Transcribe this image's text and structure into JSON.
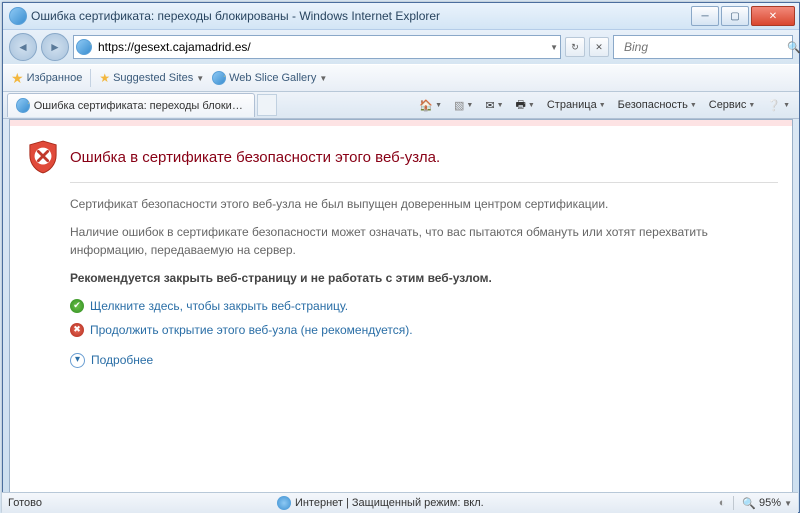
{
  "window": {
    "title": "Ошибка сертификата: переходы блокированы - Windows Internet Explorer"
  },
  "nav": {
    "url": "https://gesext.cajamadrid.es/"
  },
  "search": {
    "placeholder": "Bing"
  },
  "favbar": {
    "label": "Избранное",
    "suggested": "Suggested Sites",
    "webslice": "Web Slice Gallery"
  },
  "tab": {
    "title": "Ошибка сертификата: переходы блокированы"
  },
  "cmd": {
    "page": "Страница",
    "safety": "Безопасность",
    "service": "Сервис"
  },
  "err": {
    "title": "Ошибка в сертификате безопасности этого веб-узла.",
    "p1": "Сертификат безопасности этого веб-узла не был выпущен доверенным центром сертификации.",
    "p2": "Наличие ошибок в сертификате безопасности может означать, что вас пытаются обмануть или хотят перехватить информацию, передаваемую на сервер.",
    "rec": "Рекомендуется закрыть веб-страницу и не работать с этим веб-узлом.",
    "close_link": "Щелкните здесь, чтобы закрыть веб-страницу.",
    "continue_link": "Продолжить открытие этого веб-узла (не рекомендуется).",
    "more": "Подробнее"
  },
  "status": {
    "ready": "Готово",
    "zone": "Интернет | Защищенный режим: вкл.",
    "zoom": "95%"
  }
}
